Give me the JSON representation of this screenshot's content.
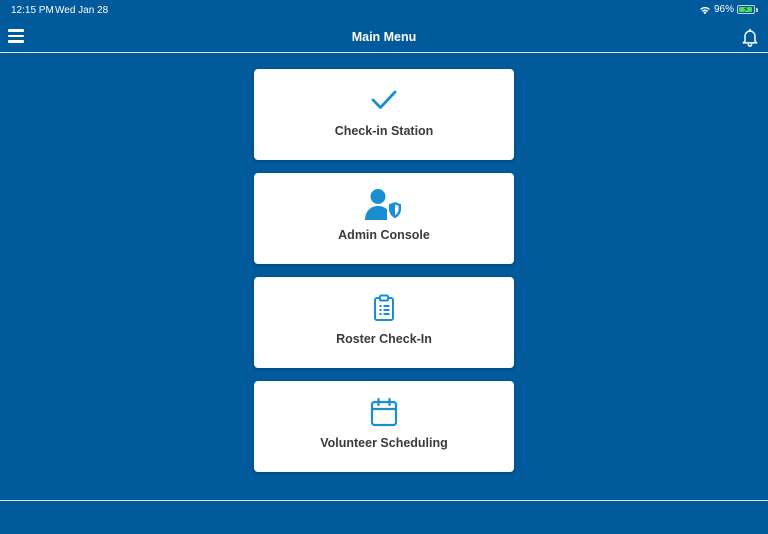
{
  "status_bar": {
    "time": "12:15 PM",
    "date": "Wed Jan 28",
    "battery_percent": "96%",
    "battery_level": 0.96,
    "icons": [
      "wifi-icon",
      "battery-charging-icon"
    ]
  },
  "nav": {
    "title": "Main Menu",
    "left_icon": "hamburger-menu-icon",
    "right_icon": "bell-icon"
  },
  "menu": {
    "items": [
      {
        "label": "Check-in Station",
        "icon": "checkmark-icon"
      },
      {
        "label": "Admin Console",
        "icon": "user-shield-icon"
      },
      {
        "label": "Roster Check-In",
        "icon": "clipboard-list-icon"
      },
      {
        "label": "Volunteer Scheduling",
        "icon": "calendar-icon"
      }
    ]
  },
  "colors": {
    "background": "#005a9c",
    "card": "#ffffff",
    "accent": "#1a8ed1",
    "card_text": "#3a3a3a",
    "battery": "#4cd964"
  }
}
